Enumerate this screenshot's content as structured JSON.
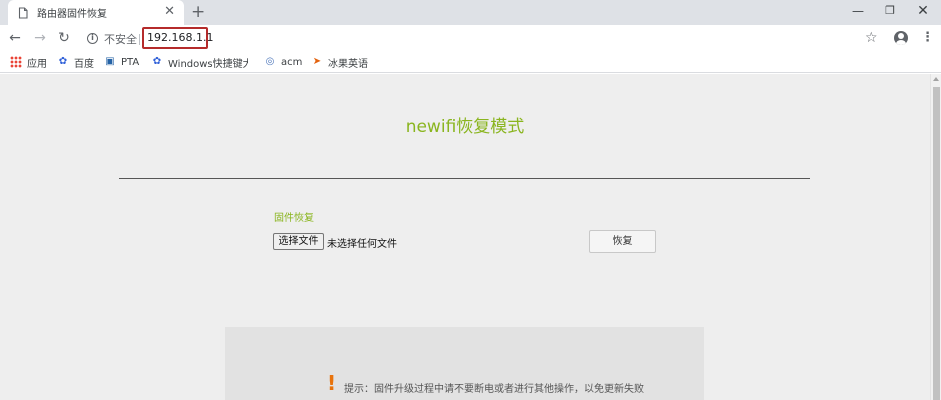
{
  "browser": {
    "tab_title": "路由器固件恢复",
    "new_tab_glyph": "+",
    "security_label": "不安全",
    "url": "192.168.1.1"
  },
  "bookmarks": [
    {
      "label": "应用",
      "icon": "apps-grid-icon"
    },
    {
      "label": "百度",
      "icon": "baidu-paw-icon"
    },
    {
      "label": "PTA",
      "icon": "pta-icon"
    },
    {
      "label": "Windows快捷键大全",
      "icon": "baidu-paw-icon"
    },
    {
      "label": "acm",
      "icon": "acm-icon"
    },
    {
      "label": "冰果英语",
      "icon": "bingguo-icon"
    }
  ],
  "page": {
    "title": "newifi恢复模式",
    "section_label": "固件恢复",
    "file_button": "选择文件",
    "file_status": "未选择任何文件",
    "restore_button": "恢复",
    "notice_icon": "!",
    "notice": "提示：固件升级过程中请不要断电或者进行其他操作，以免更新失败"
  },
  "colors": {
    "accent_green": "#8ab51f",
    "url_highlight": "#b52b2b",
    "warning_orange": "#e8730c"
  }
}
